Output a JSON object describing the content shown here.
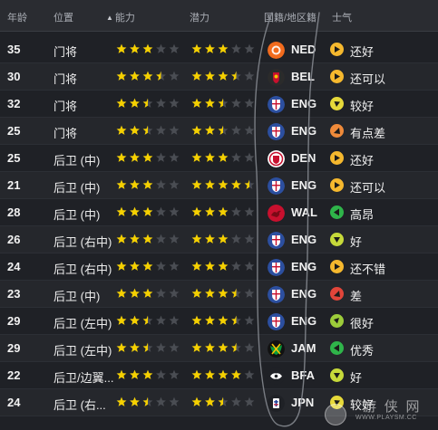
{
  "header": {
    "age": "年龄",
    "position": "位置",
    "ability": "能力",
    "potential": "潜力",
    "nationality": "国籍/地区籍",
    "morale": "士气"
  },
  "colors": {
    "star_full": "#f5d000",
    "star_empty": "#4a4d53",
    "star_potential_half": "#ffffff"
  },
  "players": [
    {
      "age": "35",
      "position": "门将",
      "ability": 3,
      "potential": 3,
      "nat": "NED",
      "flag": "netherlands",
      "morale": "还好",
      "morale_level": "okay"
    },
    {
      "age": "30",
      "position": "门将",
      "ability": 3.5,
      "potential": 3.5,
      "nat": "BEL",
      "flag": "belgium",
      "morale": "还可以",
      "morale_level": "okay"
    },
    {
      "age": "32",
      "position": "门将",
      "ability": 2.5,
      "potential": 2.5,
      "nat": "ENG",
      "flag": "england",
      "morale": "较好",
      "morale_level": "fairly-good"
    },
    {
      "age": "25",
      "position": "门将",
      "ability": 2.5,
      "potential": 2.5,
      "nat": "ENG",
      "flag": "england",
      "morale": "有点差",
      "morale_level": "poor"
    },
    {
      "age": "25",
      "position": "后卫 (中)",
      "ability": 3,
      "potential": 3,
      "nat": "DEN",
      "flag": "denmark",
      "morale": "还好",
      "morale_level": "okay"
    },
    {
      "age": "21",
      "position": "后卫 (中)",
      "ability": 3,
      "potential": 4.5,
      "nat": "ENG",
      "flag": "england",
      "morale": "还可以",
      "morale_level": "okay"
    },
    {
      "age": "28",
      "position": "后卫 (中)",
      "ability": 3,
      "potential": 3,
      "nat": "WAL",
      "flag": "wales",
      "morale": "高昂",
      "morale_level": "superb"
    },
    {
      "age": "26",
      "position": "后卫 (右中)",
      "ability": 3,
      "potential": 3,
      "nat": "ENG",
      "flag": "england",
      "morale": "好",
      "morale_level": "good"
    },
    {
      "age": "24",
      "position": "后卫 (右中)",
      "ability": 3,
      "potential": 3,
      "nat": "ENG",
      "flag": "england",
      "morale": "还不错",
      "morale_level": "okay"
    },
    {
      "age": "23",
      "position": "后卫 (中)",
      "ability": 3,
      "potential": 3.5,
      "nat": "ENG",
      "flag": "england",
      "morale": "差",
      "morale_level": "very-poor"
    },
    {
      "age": "29",
      "position": "后卫 (左中)",
      "ability": 2.5,
      "potential": 3.5,
      "nat": "ENG",
      "flag": "england",
      "morale": "很好",
      "morale_level": "very-good"
    },
    {
      "age": "29",
      "position": "后卫 (左中)",
      "ability": 2.5,
      "potential": 3.5,
      "nat": "JAM",
      "flag": "jamaica",
      "morale": "优秀",
      "morale_level": "superb"
    },
    {
      "age": "22",
      "position": "后卫/边翼...",
      "ability": 3,
      "potential": 4,
      "nat": "BFA",
      "flag": "burkina",
      "morale": "好",
      "morale_level": "good"
    },
    {
      "age": "24",
      "position": "后卫 (右...",
      "ability": 2.5,
      "potential": 2.5,
      "nat": "JPN",
      "flag": "japan",
      "morale": "较好",
      "morale_level": "fairly-good"
    }
  ],
  "watermark": {
    "site": "游 侠 网",
    "url": "WWW.PLAYSM.CC"
  }
}
